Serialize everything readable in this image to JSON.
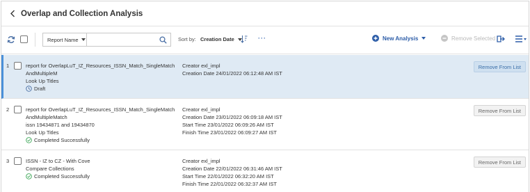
{
  "header": {
    "title": "Overlap and Collection Analysis"
  },
  "toolbar": {
    "report_name_label": "Report Name",
    "search_value": "",
    "sort_by_label": "Sort by:",
    "sort_value": "Creation Date",
    "more_label": "···",
    "new_analysis_label": "New Analysis",
    "remove_selected_label": "Remove Selected"
  },
  "colors": {
    "accent": "#2d5da8",
    "selected_row": "#dfeaf4",
    "selected_border": "#4a90d9",
    "success": "#3aa655"
  },
  "rows": [
    {
      "num": "1",
      "name": "report for OverlapLuT_IZ_Resources_ISSN_Match_SingleMatchAndMultipleM",
      "lines": [
        "Look Up Titles"
      ],
      "status": "Draft",
      "status_icon": "clock-icon",
      "creator": "Creator exl_impl",
      "creation_date": "Creation Date 24/01/2022 06:12:48 AM IST",
      "start_time": "",
      "finish_time": "",
      "action": "Remove From List"
    },
    {
      "num": "2",
      "name": "report for OverlapLuT_IZ_Resources_ISSN_Match_SingleMatchAndMultipleMatch",
      "lines": [
        "issn 19434871 and 19434870",
        "Look Up Titles"
      ],
      "status": "Completed Successfully",
      "status_icon": "check-circle-icon",
      "creator": "Creator exl_impl",
      "creation_date": "Creation Date 23/01/2022 06:09:18 AM IST",
      "start_time": "Start Time 23/01/2022 06:09:26 AM IST",
      "finish_time": "Finish Time 23/01/2022 06:09:27 AM IST",
      "action": "Remove From List"
    },
    {
      "num": "3",
      "name": "ISSN - IZ to CZ - With Cove",
      "lines": [
        "Compare Collections"
      ],
      "status": "Completed Successfully",
      "status_icon": "check-circle-icon",
      "creator": "Creator exl_impl",
      "creation_date": "Creation Date 22/01/2022 06:31:46 AM IST",
      "start_time": "Start Time 22/01/2022 06:32:20 AM IST",
      "finish_time": "Finish Time 22/01/2022 06:32:37 AM IST",
      "action": "Remove From List"
    }
  ]
}
